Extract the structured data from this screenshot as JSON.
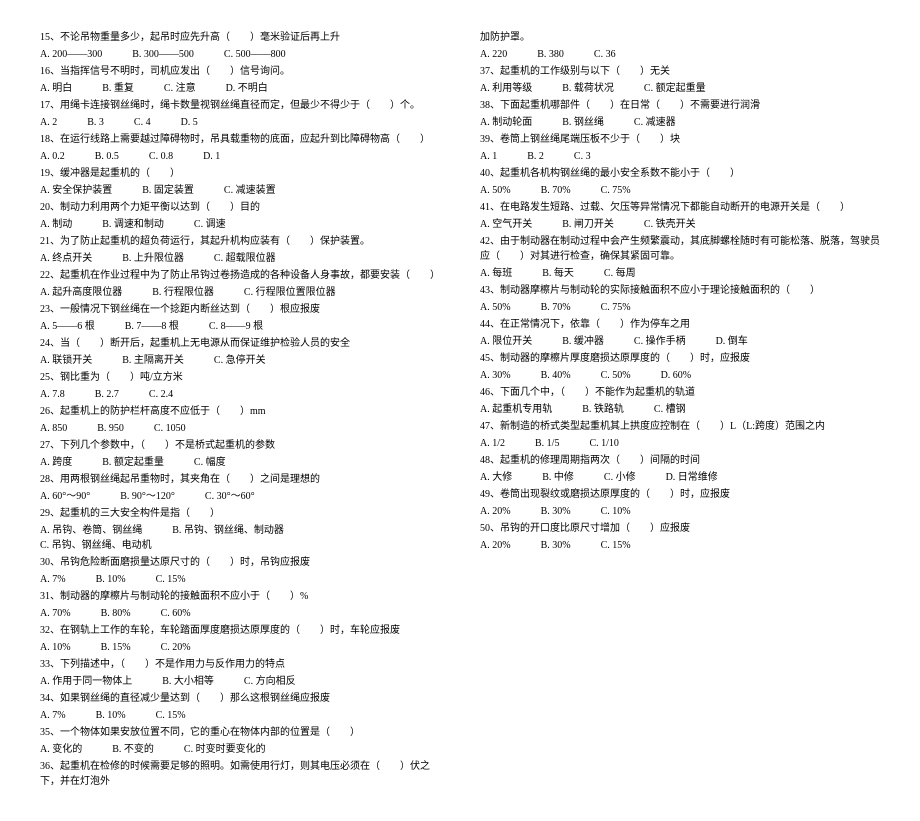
{
  "left": [
    {
      "q": "15、不论吊物重量多少，起吊时应先升高（　　）毫米验证后再上升",
      "opts": [
        "A. 200——300",
        "B. 300——500",
        "C. 500——800"
      ]
    },
    {
      "q": "16、当指挥信号不明时，司机应发出（　　）信号询问。",
      "opts": [
        "A. 明白",
        "B. 重复",
        "C. 注意",
        "D. 不明白"
      ]
    },
    {
      "q": "17、用绳卡连接钢丝绳时，绳卡数量视钢丝绳直径而定，但最少不得少于（　　）个。",
      "opts": [
        "A. 2",
        "B. 3",
        "C. 4",
        "D. 5"
      ]
    },
    {
      "q": "18、在运行线路上需要越过障碍物时，吊具载重物的底面，应起升到比障碍物高（　　）",
      "opts": [
        "A. 0.2",
        "B. 0.5",
        "C. 0.8",
        "D. 1"
      ]
    },
    {
      "q": "19、缓冲器是起重机的（　　）",
      "opts": [
        "A. 安全保护装置",
        "B. 固定装置",
        "C. 减速装置"
      ]
    },
    {
      "q": "20、制动力利用两个力矩平衡以达到（　　）目的",
      "opts": [
        "A. 制动",
        "B. 调速和制动",
        "C. 调速"
      ]
    },
    {
      "q": "21、为了防止起重机的超负荷运行，其起升机构应装有（　　）保护装置。",
      "opts": [
        "A. 终点开关",
        "B. 上升限位器",
        "C. 超载限位器"
      ]
    },
    {
      "q": "22、起重机在作业过程中为了防止吊钩过卷扬造成的各种设备人身事故，都要安装（　　）",
      "opts": [
        "A. 起升高度限位器",
        "B. 行程限位器",
        "C. 行程限位置限位器"
      ]
    },
    {
      "q": "23、一般情况下钢丝绳在一个捻距内断丝达到（　　）根应报废",
      "opts": [
        "A. 5——6 根",
        "B. 7——8 根",
        "C. 8——9 根"
      ]
    },
    {
      "q": "24、当（　　）断开后，起重机上无电源从而保证维护检验人员的安全",
      "opts": [
        "A. 联锁开关",
        "B. 主隔离开关",
        "C. 急停开关"
      ]
    },
    {
      "q": "25、钢比重为（　　）吨/立方米",
      "opts": [
        "A. 7.8",
        "B. 2.7",
        "C. 2.4"
      ]
    },
    {
      "q": "26、起重机上的防护栏杆高度不应低于（　　）mm",
      "opts": [
        "A. 850",
        "B. 950",
        "C. 1050"
      ]
    },
    {
      "q": "27、下列几个参数中，（　　）不是桥式起重机的参数",
      "opts": [
        "A. 跨度",
        "B. 额定起重量",
        "C. 幅度"
      ]
    },
    {
      "q": "28、用两根钢丝绳起吊重物时，其夹角在（　　）之间是理想的",
      "opts": [
        "A. 60°～90°",
        "B. 90°～120°",
        "C. 30°～60°"
      ]
    },
    {
      "q": "29、起重机的三大安全构件是指（　　）",
      "opts": [
        "A. 吊钩、卷筒、钢丝绳",
        "B. 吊钩、钢丝绳、制动器",
        "C. 吊钩、钢丝绳、电动机"
      ]
    },
    {
      "q": "30、吊钩危险断面磨损量达原尺寸的（　　）时，吊钩应报废",
      "opts": [
        "A. 7%",
        "B. 10%",
        "C. 15%"
      ]
    },
    {
      "q": "31、制动器的摩檫片与制动轮的接触面积不应小于（　　）%",
      "opts": [
        "A. 70%",
        "B. 80%",
        "C. 60%"
      ]
    },
    {
      "q": "32、在钢轨上工作的车轮，车轮踏面厚度磨损达原厚度的（　　）时，车轮应报废",
      "opts": [
        "A. 10%",
        "B. 15%",
        "C. 20%"
      ]
    },
    {
      "q": "33、下列描述中，（　　）不是作用力与反作用力的特点",
      "opts": [
        "A. 作用于同一物体上",
        "B. 大小相等",
        "C. 方向相反"
      ]
    },
    {
      "q": "34、如果钢丝绳的直径减少量达到（　　）那么这根钢丝绳应报废",
      "opts": [
        "A. 7%",
        "B. 10%",
        "C. 15%"
      ]
    },
    {
      "q": "35、一个物体如果安放位置不同，它的重心在物体内部的位置是（　　）",
      "opts": [
        "A. 变化的",
        "B. 不变的",
        "C. 时变时要变化的"
      ]
    },
    {
      "q": "36、起重机在检修的时候需要足够的照明。如需使用行灯，则其电压必须在（　　）伏之下，并在灯泡外",
      "opts": []
    }
  ],
  "right": [
    {
      "q": "加防护罩。",
      "opts": [
        "A. 220",
        "B. 380",
        "C. 36"
      ]
    },
    {
      "q": "37、起重机的工作级别与以下（　　）无关",
      "opts": [
        "A. 利用等级",
        "B. 载荷状况",
        "C. 额定起重量"
      ]
    },
    {
      "q": "38、下面起重机哪部件（　　）在日常（　　）不需要进行润滑",
      "opts": [
        "A. 制动轮面",
        "B. 钢丝绳",
        "C. 减速器"
      ]
    },
    {
      "q": "39、卷筒上钢丝绳尾端压板不少于（　　）块",
      "opts": [
        "A. 1",
        "B. 2",
        "C. 3"
      ]
    },
    {
      "q": "40、起重机各机构钢丝绳的最小安全系数不能小于（　　）",
      "opts": [
        "A. 50%",
        "B. 70%",
        "C. 75%"
      ]
    },
    {
      "q": "41、在电路发生短路、过载、欠压等异常情况下都能自动断开的电源开关是（　　）",
      "opts": [
        "A. 空气开关",
        "B. 闸刀开关",
        "C. 铁壳开关"
      ]
    },
    {
      "q": "42、由于制动器在制动过程中会产生频繁震动，其底脚螺栓随时有可能松落、脱落，驾驶员应（　　）对其进行检查，确保其紧固可靠。",
      "opts": [
        "A. 每班",
        "B. 每天",
        "C. 每周"
      ]
    },
    {
      "q": "43、制动器摩檫片与制动轮的实际接触面积不应小于理论接触面积的（　　）",
      "opts": [
        "A. 50%",
        "B. 70%",
        "C. 75%"
      ]
    },
    {
      "q": "44、在正常情况下，依靠（　　）作为停车之用",
      "opts": [
        "A. 限位开关",
        "B. 缓冲器",
        "C. 操作手柄",
        "D. 倒车"
      ]
    },
    {
      "q": "45、制动器的摩檫片厚度磨损达原厚度的（　　）时，应报废",
      "opts": [
        "A. 30%",
        "B. 40%",
        "C. 50%",
        "D. 60%"
      ]
    },
    {
      "q": "46、下面几个中，（　　）不能作为起重机的轨道",
      "opts": [
        "A. 起重机专用轨",
        "B. 铁路轨",
        "C. 槽钢"
      ]
    },
    {
      "q": "47、新制造的桥式类型起重机其上拱度应控制在（　　）L（L:跨度）范围之内",
      "opts": [
        "A. 1/2",
        "B. 1/5",
        "C. 1/10"
      ]
    },
    {
      "q": "48、起重机的修理周期指两次（　　）间隔的时间",
      "opts": [
        "A. 大修",
        "B. 中修",
        "C. 小修",
        "D. 日常维修"
      ]
    },
    {
      "q": "49、卷筒出现裂纹或磨损达原厚度的（　　）时，应报废",
      "opts": [
        "A. 20%",
        "B. 30%",
        "C. 10%"
      ]
    },
    {
      "q": "50、吊钩的开口度比原尺寸增加（　　）应报废",
      "opts": [
        "A. 20%",
        "B. 30%",
        "C. 15%"
      ]
    }
  ]
}
